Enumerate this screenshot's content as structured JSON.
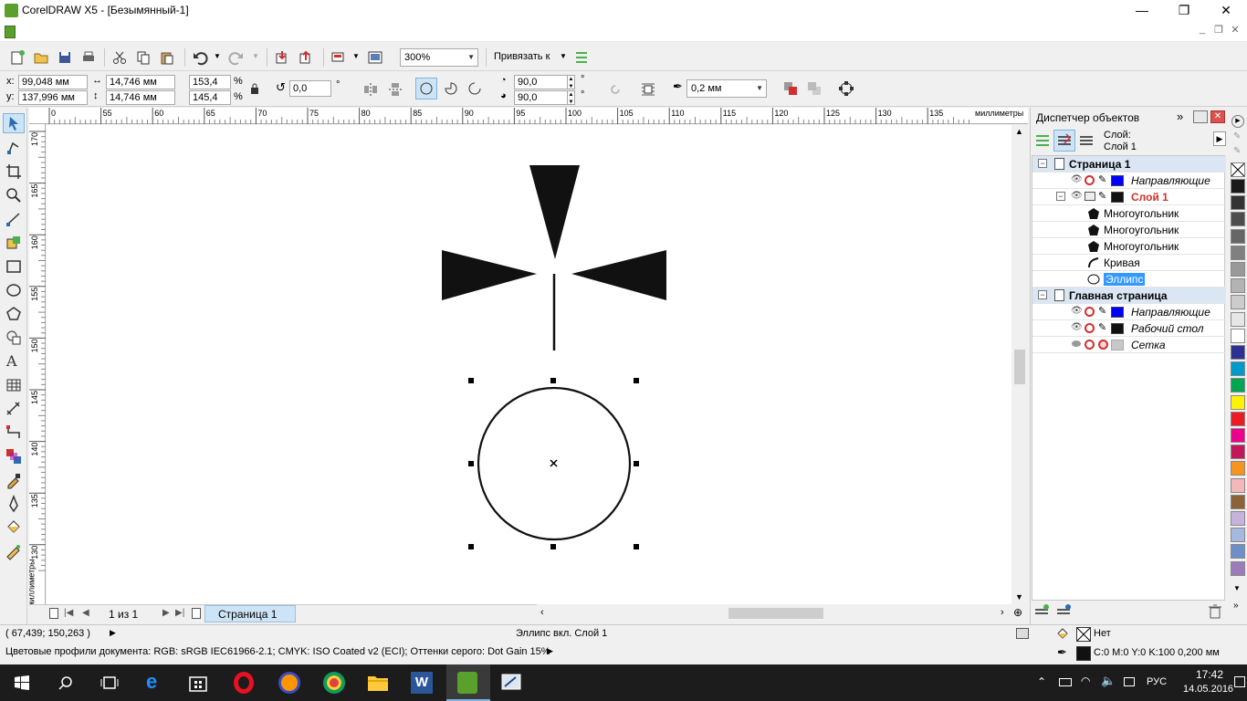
{
  "window": {
    "title": "CorelDRAW X5 - [Безымянный-1]",
    "min": "—",
    "max": "❐",
    "close": "✕"
  },
  "mdi": {
    "min": "_",
    "restore": "❐",
    "close": "✕"
  },
  "toolbar": {
    "zoom": "300%",
    "snap_label": "Привязать к"
  },
  "props": {
    "x_label": "x:",
    "x": "99,048 мм",
    "y_label": "y:",
    "y": "137,996 мм",
    "w": "14,746 мм",
    "h": "14,746 мм",
    "sx": "153,4",
    "sy": "145,4",
    "pct": "%",
    "rotation": "0,0",
    "deg": "°",
    "angle1": "90,0",
    "angle2": "90,0",
    "outline": "0,2 мм"
  },
  "ruler": {
    "h_ticks": [
      "0",
      "55",
      "60",
      "65",
      "70",
      "75",
      "80",
      "85",
      "90",
      "95",
      "100",
      "105",
      "110",
      "115",
      "120",
      "125",
      "130",
      "135"
    ],
    "h_unit": "миллиметры",
    "v_ticks": [
      "170",
      "165",
      "160",
      "155",
      "150",
      "145",
      "140",
      "135",
      "130"
    ],
    "v_unit": "миллиметры"
  },
  "pagenav": {
    "counter": "1 из 1",
    "tab": "Страница 1"
  },
  "status": {
    "coords": "( 67,439; 150,263 )",
    "selection": "Эллипс вкл. Слой 1",
    "fill_label": "Нет",
    "profiles": "Цветовые профили документа: RGB: sRGB IEC61966-2.1; CMYK: ISO Coated v2 (ECI); Оттенки серого: Dot Gain 15%",
    "outline_info": "C:0 M:0 Y:0 K:100  0,200 мм"
  },
  "docker": {
    "title": "Диспетчер объектов",
    "layer_label": "Слой:",
    "layer_name": "Слой 1",
    "tree": [
      {
        "label": "Страница 1",
        "type": "page"
      },
      {
        "label": "Направляющие",
        "type": "layer",
        "color": "#0000ff"
      },
      {
        "label": "Слой 1",
        "type": "layer-active",
        "color": "#111111"
      },
      {
        "label": "Многоугольник",
        "type": "object"
      },
      {
        "label": "Многоугольник",
        "type": "object"
      },
      {
        "label": "Многоугольник",
        "type": "object"
      },
      {
        "label": "Кривая",
        "type": "object"
      },
      {
        "label": "Эллипс",
        "type": "object-selected"
      },
      {
        "label": "Главная страница",
        "type": "page"
      },
      {
        "label": "Направляющие",
        "type": "layer",
        "color": "#0000ff"
      },
      {
        "label": "Рабочий стол",
        "type": "layer",
        "color": "#111111"
      },
      {
        "label": "Сетка",
        "type": "layer",
        "color": "#c8c8c8"
      }
    ]
  },
  "palette": [
    "#1a1a1a",
    "#333333",
    "#4d4d4d",
    "#666666",
    "#808080",
    "#999999",
    "#b3b3b3",
    "#cccccc",
    "#e6e6e6",
    "#ffffff",
    "#2e3192",
    "#0099cc",
    "#00a651",
    "#fff200",
    "#ed1c24",
    "#ec008c",
    "#c2185b",
    "#f7941d",
    "#f5b8b8",
    "#8c6239",
    "#c7b2de",
    "#a4b8e0",
    "#6d8fc7",
    "#9b7bb8"
  ],
  "taskbar": {
    "lang": "РУС",
    "time": "17:42",
    "date": "14.05.2016"
  }
}
